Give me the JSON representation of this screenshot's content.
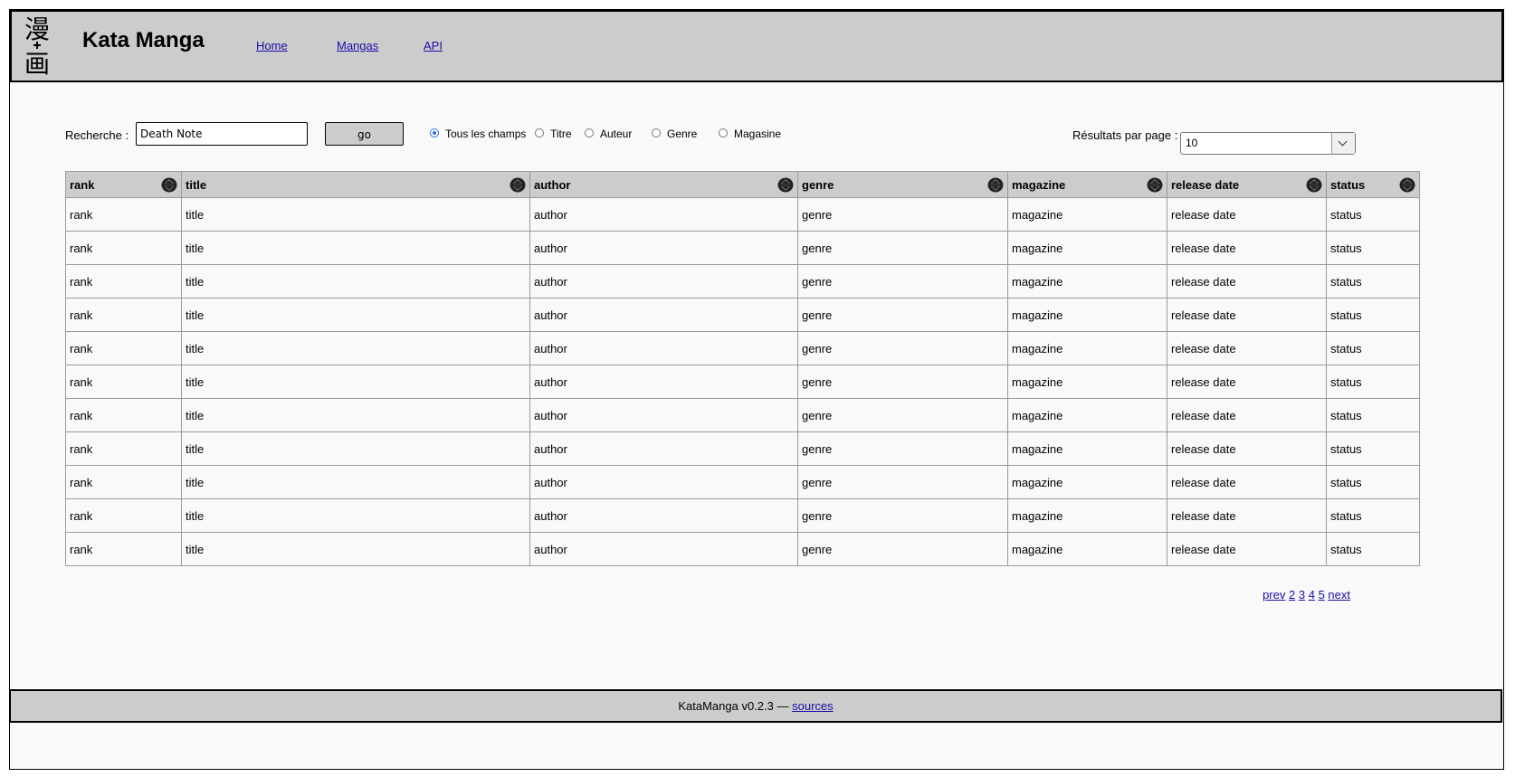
{
  "header": {
    "logo_chars": [
      "漫",
      "画"
    ],
    "title": "Kata Manga",
    "nav": [
      {
        "label": "Home"
      },
      {
        "label": "Mangas"
      },
      {
        "label": "API"
      }
    ]
  },
  "search": {
    "label": "Recherche :",
    "value": "Death Note",
    "go_label": "go",
    "fields": [
      {
        "label": "Tous les champs",
        "checked": true
      },
      {
        "label": "Titre",
        "checked": false
      },
      {
        "label": "Auteur",
        "checked": false
      },
      {
        "label": "Genre",
        "checked": false
      },
      {
        "label": "Magasine",
        "checked": false
      }
    ],
    "results_per_page_label": "Résultats par page :",
    "results_per_page": "10"
  },
  "table": {
    "columns": [
      "rank",
      "title",
      "author",
      "genre",
      "magazine",
      "release date",
      "status"
    ],
    "rows": [
      [
        "rank",
        "title",
        "author",
        "genre",
        "magazine",
        "release date",
        "status"
      ],
      [
        "rank",
        "title",
        "author",
        "genre",
        "magazine",
        "release date",
        "status"
      ],
      [
        "rank",
        "title",
        "author",
        "genre",
        "magazine",
        "release date",
        "status"
      ],
      [
        "rank",
        "title",
        "author",
        "genre",
        "magazine",
        "release date",
        "status"
      ],
      [
        "rank",
        "title",
        "author",
        "genre",
        "magazine",
        "release date",
        "status"
      ],
      [
        "rank",
        "title",
        "author",
        "genre",
        "magazine",
        "release date",
        "status"
      ],
      [
        "rank",
        "title",
        "author",
        "genre",
        "magazine",
        "release date",
        "status"
      ],
      [
        "rank",
        "title",
        "author",
        "genre",
        "magazine",
        "release date",
        "status"
      ],
      [
        "rank",
        "title",
        "author",
        "genre",
        "magazine",
        "release date",
        "status"
      ],
      [
        "rank",
        "title",
        "author",
        "genre",
        "magazine",
        "release date",
        "status"
      ],
      [
        "rank",
        "title",
        "author",
        "genre",
        "magazine",
        "release date",
        "status"
      ]
    ]
  },
  "pagination": {
    "prev": "prev",
    "pages": [
      "2",
      "3",
      "4",
      "5"
    ],
    "next": "next"
  },
  "footer": {
    "text": "KataManga v0.2.3 —",
    "link": "sources"
  },
  "icons": {
    "sort": "sort-up-down-icon",
    "dropdown": "chevron-down-icon"
  }
}
